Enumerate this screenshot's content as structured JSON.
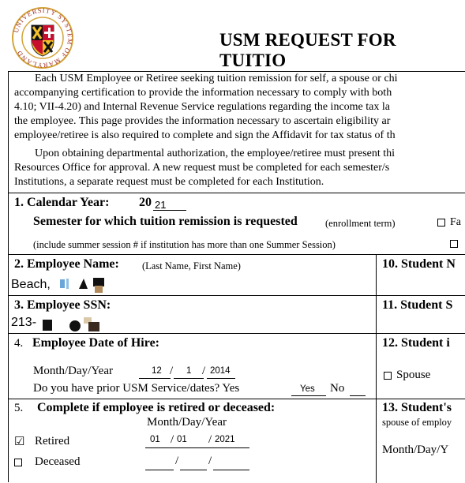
{
  "logo": {
    "ring_text": "UNIVERSITY SYSTEM OF MARYLAND"
  },
  "header": {
    "title": "USM REQUEST FOR TUITIO"
  },
  "intro": {
    "lines": [
      "Each USM Employee or Retiree seeking tuition remission for self, a spouse or chi",
      "accompanying certification to provide the information necessary to comply with both",
      "4.10; VII-4.20) and Internal Revenue Service regulations regarding the income tax la",
      "the employee.  This page provides the information necessary to ascertain eligibility ar",
      "employee/retiree is also required to complete and sign the Affidavit for tax status of th",
      "Upon obtaining departmental authorization, the employee/retiree must present thi",
      "Resources Office for approval.  A new request must be completed for each semester/s",
      "Institutions, a separate request must be completed for each Institution."
    ]
  },
  "section1": {
    "label": "1. Calendar Year:",
    "year_prefix": "20",
    "year_value": "21",
    "semester_label": "Semester for which tuition remission is requested",
    "enrollment_term": "(enrollment term)",
    "option_fa": "Fa",
    "summer_note": "(include summer session # if institution has more than one Summer Session)"
  },
  "section2": {
    "label": "2. Employee Name:",
    "sub": "(Last Name, First Name)",
    "value": "Beach,"
  },
  "section3": {
    "label": "3. Employee SSN:",
    "value": "213-"
  },
  "section4": {
    "number": "4.",
    "label": "Employee Date of Hire:",
    "date_label": "Month/Day/Year",
    "month": "12",
    "day": "1",
    "year": "2014",
    "prior_question": "Do you have prior USM Service/dates? Yes",
    "prior_yes_value": "Yes",
    "prior_no": "No"
  },
  "section5": {
    "number": "5.",
    "label": "Complete if employee is retired or deceased:",
    "date_label": "Month/Day/Year",
    "retired_label": "Retired",
    "retired_month": "01",
    "retired_day": "01",
    "retired_year": "2021",
    "deceased_label": "Deceased"
  },
  "right": {
    "s10": "10. Student N",
    "s11": "11. Student S",
    "s12": "12. Student i",
    "spouse_label": "Spouse",
    "s13": "13. Student's",
    "s13_sub": "spouse of employ",
    "s13_date": "Month/Day/Y"
  }
}
